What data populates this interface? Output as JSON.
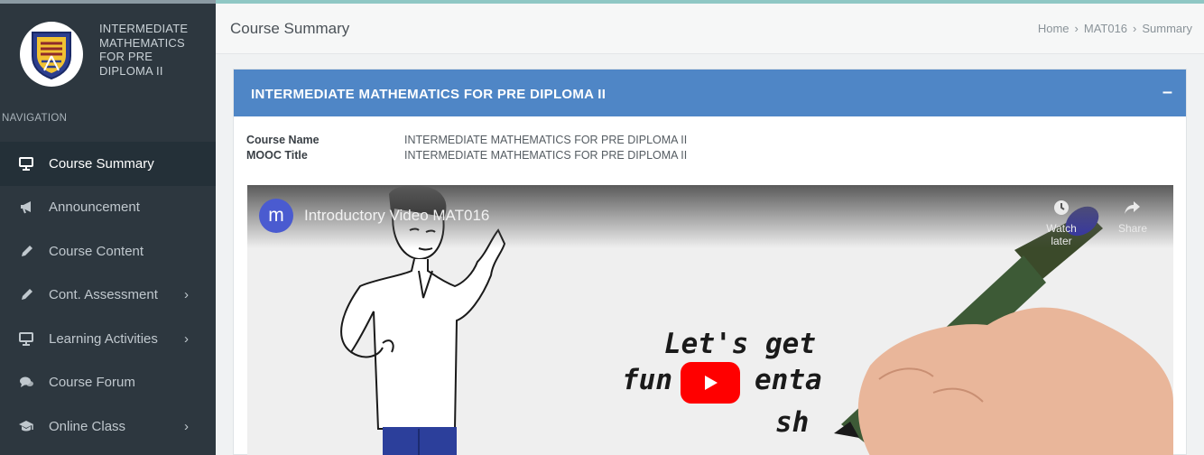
{
  "sidebar": {
    "brand_title": "INTERMEDIATE MATHEMATICS FOR PRE DIPLOMA II",
    "nav_heading": "NAVIGATION",
    "items": [
      {
        "label": "Course Summary",
        "icon": "monitor-icon",
        "active": true
      },
      {
        "label": "Announcement",
        "icon": "megaphone-icon"
      },
      {
        "label": "Course Content",
        "icon": "pencil-icon"
      },
      {
        "label": "Cont. Assessment",
        "icon": "pencil-icon",
        "has_submenu": true
      },
      {
        "label": "Learning Activities",
        "icon": "monitor-icon",
        "has_submenu": true
      },
      {
        "label": "Course Forum",
        "icon": "chat-icon"
      },
      {
        "label": "Online Class",
        "icon": "graduation-cap-icon",
        "has_submenu": true
      }
    ],
    "chevron": "›"
  },
  "header": {
    "title": "Course Summary",
    "breadcrumb": [
      "Home",
      "MAT016",
      "Summary"
    ],
    "sep": "›"
  },
  "panel": {
    "title": "INTERMEDIATE MATHEMATICS FOR PRE DIPLOMA II",
    "collapse_symbol": "–",
    "fields": [
      {
        "key": "Course Name",
        "value": "INTERMEDIATE MATHEMATICS FOR PRE DIPLOMA II"
      },
      {
        "key": "MOOC Title",
        "value": "INTERMEDIATE MATHEMATICS FOR PRE DIPLOMA II"
      }
    ]
  },
  "video": {
    "channel_initial": "m",
    "title": "Introductory Video MAT016",
    "watch_later": "Watch later",
    "share": "Share",
    "handwriting": [
      "Let's get",
      "fun",
      "enta",
      "sh"
    ]
  },
  "colors": {
    "sidebar_bg": "#2d373f",
    "panel_header": "#4f86c6",
    "play_button": "#ff0000",
    "channel_avatar": "#4a5bd0"
  }
}
